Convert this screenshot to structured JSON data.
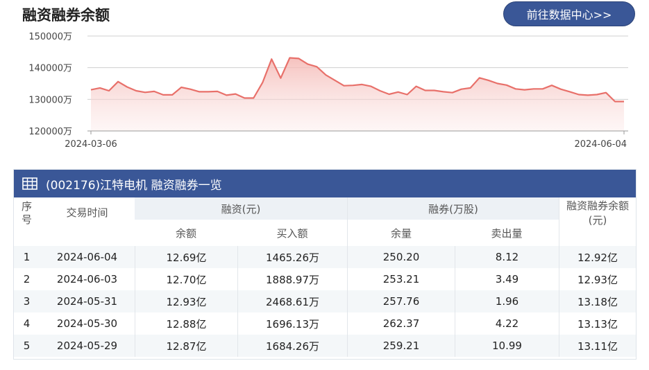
{
  "header": {
    "title": "融资融券余额",
    "center_link": "前往数据中心>>"
  },
  "chart_data": {
    "type": "area",
    "title": "",
    "xlabel": "",
    "ylabel": "",
    "y_unit_suffix": "万",
    "y_ticks": [
      "120000万",
      "130000万",
      "140000万",
      "150000万"
    ],
    "ylim": [
      120000,
      150000
    ],
    "x_tick_labels": [
      "2024-03-06",
      "2024-06-04"
    ],
    "x_start": "2024-03-06",
    "x_end": "2024-06-04",
    "line_color": "#e8706a",
    "fill_color": "#f6c9c6",
    "grid": true,
    "values": [
      133000,
      133600,
      132700,
      135600,
      133900,
      132700,
      132200,
      132500,
      131400,
      131400,
      133800,
      133200,
      132400,
      132400,
      132500,
      131300,
      131700,
      130400,
      130400,
      135300,
      142700,
      136700,
      143100,
      142900,
      141100,
      140300,
      137700,
      136000,
      134300,
      134400,
      134700,
      134100,
      132700,
      131600,
      132300,
      131500,
      134100,
      132800,
      132800,
      132400,
      132100,
      133200,
      133600,
      136800,
      136000,
      135000,
      134500,
      133300,
      133000,
      133300,
      133300,
      134400,
      133200,
      132400,
      131500,
      131300,
      131500,
      132100,
      129300,
      129300
    ]
  },
  "table": {
    "title": "(002176)江特电机 融资融券一览",
    "headers": {
      "index": "序号",
      "date": "交易时间",
      "financing": "融资(元)",
      "financing_balance": "余额",
      "financing_buy": "买入额",
      "securities": "融券(万股)",
      "securities_balance": "余量",
      "securities_sell": "卖出量",
      "total": "融资融券余额(元)"
    },
    "rows": [
      {
        "no": "1",
        "date": "2024-06-04",
        "fin_bal": "12.69亿",
        "fin_buy": "1465.26万",
        "sec_bal": "250.20",
        "sec_sell": "8.12",
        "total": "12.92亿"
      },
      {
        "no": "2",
        "date": "2024-06-03",
        "fin_bal": "12.70亿",
        "fin_buy": "1888.97万",
        "sec_bal": "253.21",
        "sec_sell": "3.49",
        "total": "12.93亿"
      },
      {
        "no": "3",
        "date": "2024-05-31",
        "fin_bal": "12.93亿",
        "fin_buy": "2468.61万",
        "sec_bal": "257.76",
        "sec_sell": "1.96",
        "total": "13.18亿"
      },
      {
        "no": "4",
        "date": "2024-05-30",
        "fin_bal": "12.88亿",
        "fin_buy": "1696.13万",
        "sec_bal": "262.37",
        "sec_sell": "4.22",
        "total": "13.13亿"
      },
      {
        "no": "5",
        "date": "2024-05-29",
        "fin_bal": "12.87亿",
        "fin_buy": "1684.26万",
        "sec_bal": "259.21",
        "sec_sell": "10.99",
        "total": "13.11亿"
      }
    ]
  }
}
